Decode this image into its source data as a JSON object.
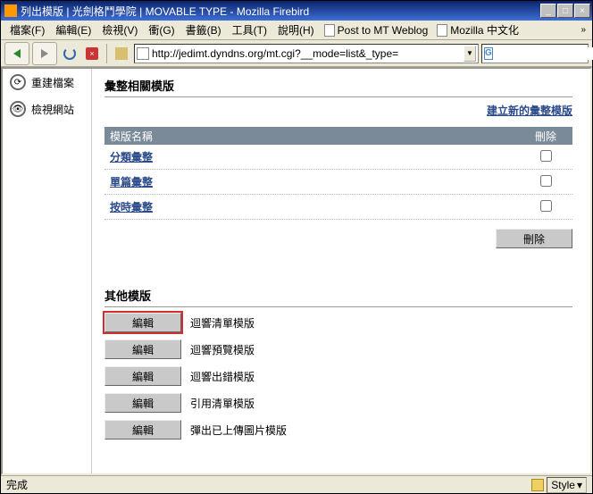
{
  "titlebar": {
    "text": "列出模版 | 光劍格鬥學院 | MOVABLE TYPE - Mozilla Firebird"
  },
  "winbtns": {
    "min": "_",
    "max": "□",
    "close": "×"
  },
  "menu": {
    "file": "檔案(F)",
    "edit": "編輯(E)",
    "view": "檢視(V)",
    "go": "衝(G)",
    "bookmarks": "書籤(B)",
    "tools": "工具(T)",
    "help": "說明(H)"
  },
  "bookmarks": {
    "b1": "Post to MT Weblog",
    "b2": "Mozilla 中文化"
  },
  "url": {
    "value": "http://jedimt.dyndns.org/mt.cgi?__mode=list&_type="
  },
  "search": {
    "icon_letter": "G"
  },
  "sidebar": {
    "items": [
      {
        "label": "重建檔案",
        "icon": "⟳"
      },
      {
        "label": "檢視網站",
        "icon": "👁"
      }
    ]
  },
  "section1": {
    "title": "彙整相關模版",
    "create_link": "建立新的彙整模版",
    "col_name": "模版名稱",
    "col_del": "刪除",
    "rows": [
      {
        "name": "分類彙整"
      },
      {
        "name": "單篇彙整"
      },
      {
        "name": "按時彙整"
      }
    ],
    "delete_btn": "刪除"
  },
  "section2": {
    "title": "其他模版",
    "edit_btn": "編輯",
    "rows": [
      {
        "label": "迴響清單模版"
      },
      {
        "label": "迴響預覽模版"
      },
      {
        "label": "迴響出錯模版"
      },
      {
        "label": "引用清單模版"
      },
      {
        "label": "彈出已上傳圖片模版"
      }
    ]
  },
  "status": {
    "left": "完成",
    "style": "Style"
  }
}
